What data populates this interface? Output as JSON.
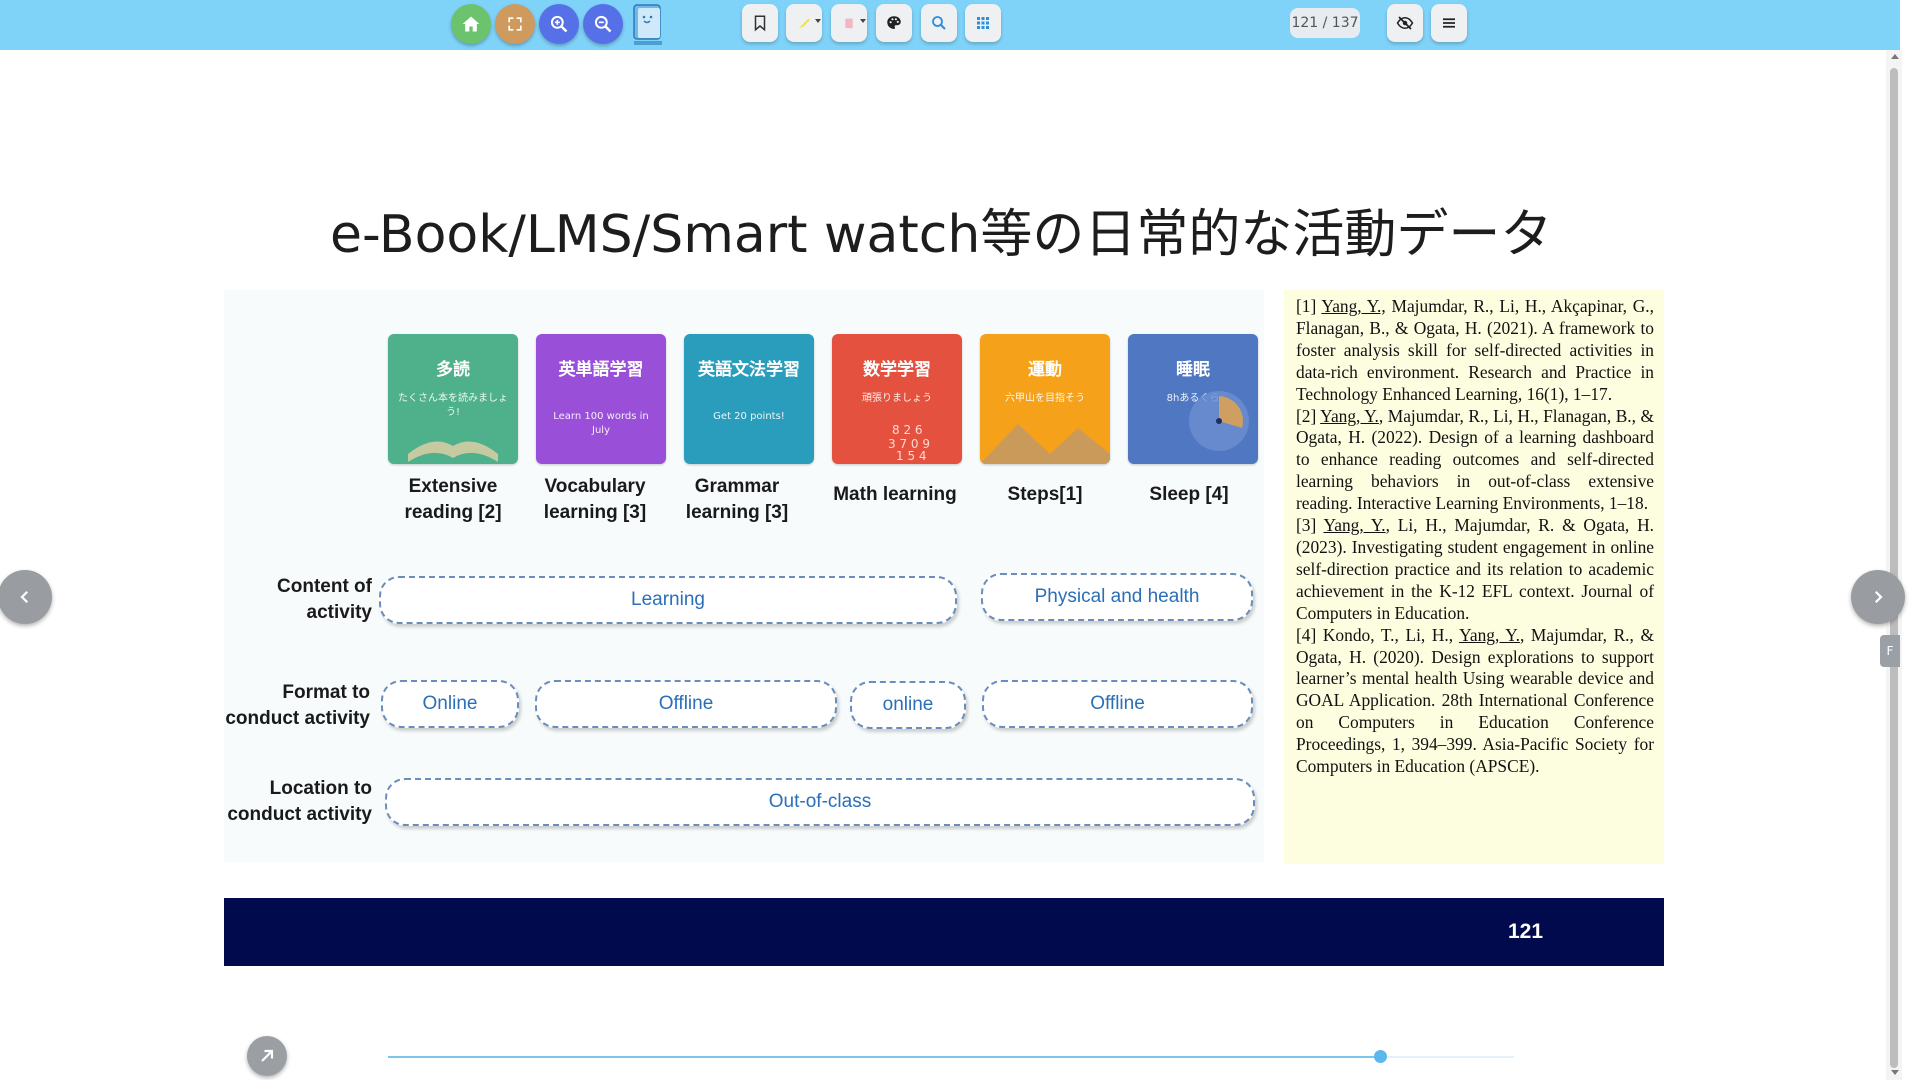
{
  "toolbar": {
    "buttons": [
      {
        "name": "home",
        "color": "#6cc36e"
      },
      {
        "name": "fullscreen",
        "color": "#cf9a5e"
      },
      {
        "name": "zoom-in",
        "color": "#5670e8"
      },
      {
        "name": "zoom-out",
        "color": "#5670e8"
      }
    ],
    "page_indicator": "121 / 137"
  },
  "slide": {
    "title": "e-Book/LMS/Smart watch等の日常的な活動データ",
    "cards": [
      {
        "title": "多読",
        "subtitle": "たくさん本を読みましょう!",
        "label": "Extensive reading [2]",
        "color": "#4fb08c"
      },
      {
        "title": "英単語学習",
        "subtitle": "Learn 100 words in July",
        "label": "Vocabulary learning [3]",
        "color": "#9a4fd8"
      },
      {
        "title": "英語文法学習",
        "subtitle": "Get 20 points!",
        "label": "Grammar learning [3]",
        "color": "#2a9dbc"
      },
      {
        "title": "数学学習",
        "subtitle": "頑張りましょう",
        "label": "Math learning",
        "color": "#e4523f"
      },
      {
        "title": "運動",
        "subtitle": "六甲山を目指そう",
        "label": "Steps[1]",
        "color": "#f5a21a"
      },
      {
        "title": "睡眠",
        "subtitle": "8hあるくら",
        "label": "Sleep [4]",
        "color": "#4f77c2"
      }
    ],
    "rows": {
      "content_label": "Content of activity",
      "format_label": "Format to conduct activity",
      "location_label": "Location to conduct activity"
    },
    "pills": {
      "learning": "Learning",
      "physical": "Physical and health",
      "online1": "Online",
      "offline1": "Offline",
      "online2": "online",
      "offline2": "Offline",
      "outofclass": "Out-of-class"
    },
    "references": {
      "r1_prefix": "[1] ",
      "r1_author": "Yang, Y.,",
      "r1_text": " Majumdar, R., Li, H., Akçapinar, G., Flanagan, B., & Ogata, H. (2021). A framework to foster analysis skill for self-directed activities in data-rich environment. Research and Practice in Technology Enhanced Learning, 16(1), 1–17.",
      "r2_prefix": "[2] ",
      "r2_author": "Yang, Y.",
      "r2_text": ", Majumdar, R., Li, H., Flanagan, B., & Ogata, H. (2022). Design of a learning dashboard to enhance reading outcomes and self-directed learning behaviors in out-of-class extensive reading. Interactive Learning Environments, 1–18.",
      "r3_prefix": "[3] ",
      "r3_author": "Yang, Y.",
      "r3_text": ", Li, H., Majumdar, R. & Ogata, H. (2023). Investigating student engagement in online self-direction practice and its relation to academic achievement in the K-12 EFL context. Journal of Computers in Education.",
      "r4_prefix": "[4] Kondo, T., Li, H., ",
      "r4_author": "Yang, Y.",
      "r4_text": ", Majumdar, R., & Ogata, H. (2020). Design explorations to support learner’s mental health Using wearable device and GOAL Application. 28th International Conference on Computers in Education Conference Proceedings, 1, 394–399. Asia-Pacific Society for Computers in Education (APSCE)."
    },
    "page_number": "121"
  },
  "side_tab_label": "F",
  "slider": {
    "progress": 0.881
  },
  "colors": {
    "toolbar_bg": "#7fd2f8",
    "footer_bar": "#000a4c",
    "refs_bg": "#fdfde0",
    "pill_text": "#2a6fb8"
  }
}
